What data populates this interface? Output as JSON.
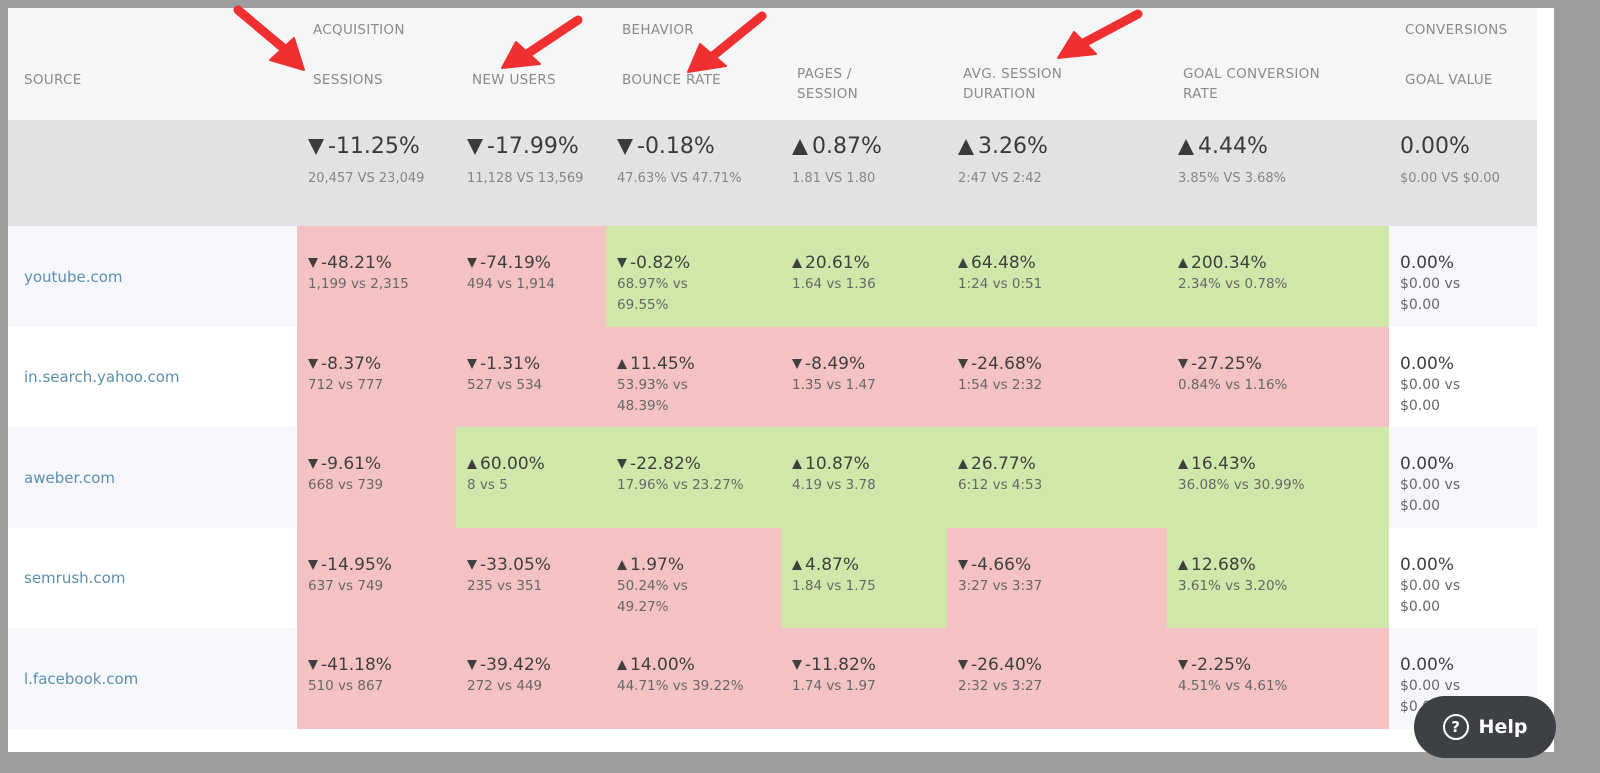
{
  "header": {
    "groups": {
      "acquisition": "ACQUISITION",
      "behavior": "BEHAVIOR",
      "conversions": "CONVERSIONS"
    },
    "columns": {
      "source": "SOURCE",
      "sessions": "SESSIONS",
      "new_users": "NEW USERS",
      "bounce_rate": "BOUNCE RATE",
      "pages_session_l1": "PAGES /",
      "pages_session_l2": "SESSION",
      "avg_session_l1": "AVG. SESSION",
      "avg_session_l2": "DURATION",
      "goal_conv_l1": "GOAL CONVERSION",
      "goal_conv_l2": "RATE",
      "goal_value": "GOAL VALUE"
    }
  },
  "colors": {
    "negative_cell": "#f4c2c2",
    "positive_cell": "#cfe8a9",
    "arrow_red": "#e0353b",
    "arrow_green": "#6aa33a",
    "annotation_arrow": "#f03030",
    "link": "#5a8fb0"
  },
  "summary": {
    "sessions": {
      "change": "-11.25%",
      "direction": "down",
      "tone": "red",
      "compare": "20,457 VS 23,049"
    },
    "new_users": {
      "change": "-17.99%",
      "direction": "down",
      "tone": "red",
      "compare": "11,128 VS 13,569"
    },
    "bounce_rate": {
      "change": "-0.18%",
      "direction": "down",
      "tone": "green",
      "compare": "47.63% VS 47.71%"
    },
    "pages_session": {
      "change": "0.87%",
      "direction": "up",
      "tone": "green",
      "compare": "1.81 VS 1.80"
    },
    "avg_session": {
      "change": "3.26%",
      "direction": "up",
      "tone": "green",
      "compare": "2:47 VS 2:42"
    },
    "goal_conv": {
      "change": "4.44%",
      "direction": "up",
      "tone": "green",
      "compare": "3.85% VS 3.68%"
    },
    "goal_value": {
      "change": "0.00%",
      "compare": "$0.00 VS $0.00"
    }
  },
  "rows": [
    {
      "source": "youtube.com",
      "sessions": {
        "change": "-48.21%",
        "direction": "down",
        "tone": "red",
        "compare": "1,199 vs 2,315"
      },
      "new_users": {
        "change": "-74.19%",
        "direction": "down",
        "tone": "red",
        "compare": "494 vs 1,914"
      },
      "bounce_rate": {
        "change": "-0.82%",
        "direction": "down",
        "tone": "green",
        "compare": "68.97% vs 69.55%"
      },
      "pages_session": {
        "change": "20.61%",
        "direction": "up",
        "tone": "green",
        "compare": "1.64 vs 1.36"
      },
      "avg_session": {
        "change": "64.48%",
        "direction": "up",
        "tone": "green",
        "compare": "1:24 vs 0:51"
      },
      "goal_conv": {
        "change": "200.34%",
        "direction": "up",
        "tone": "green",
        "compare": "2.34% vs 0.78%"
      },
      "goal_value": {
        "change": "0.00%",
        "compare_1": "$0.00 vs",
        "compare_2": "$0.00"
      }
    },
    {
      "source": "in.search.yahoo.com",
      "sessions": {
        "change": "-8.37%",
        "direction": "down",
        "tone": "red",
        "compare": "712 vs 777"
      },
      "new_users": {
        "change": "-1.31%",
        "direction": "down",
        "tone": "red",
        "compare": "527 vs 534"
      },
      "bounce_rate": {
        "change": "11.45%",
        "direction": "up",
        "tone": "red",
        "compare": "53.93% vs 48.39%"
      },
      "pages_session": {
        "change": "-8.49%",
        "direction": "down",
        "tone": "red",
        "compare": "1.35 vs 1.47"
      },
      "avg_session": {
        "change": "-24.68%",
        "direction": "down",
        "tone": "red",
        "compare": "1:54 vs 2:32"
      },
      "goal_conv": {
        "change": "-27.25%",
        "direction": "down",
        "tone": "red",
        "compare": "0.84% vs 1.16%"
      },
      "goal_value": {
        "change": "0.00%",
        "compare_1": "$0.00 vs",
        "compare_2": "$0.00"
      }
    },
    {
      "source": "aweber.com",
      "sessions": {
        "change": "-9.61%",
        "direction": "down",
        "tone": "red",
        "compare": "668 vs 739"
      },
      "new_users": {
        "change": "60.00%",
        "direction": "up",
        "tone": "green",
        "compare": "8 vs 5"
      },
      "bounce_rate": {
        "change": "-22.82%",
        "direction": "down",
        "tone": "green",
        "compare": "17.96% vs 23.27%"
      },
      "pages_session": {
        "change": "10.87%",
        "direction": "up",
        "tone": "green",
        "compare": "4.19 vs 3.78"
      },
      "avg_session": {
        "change": "26.77%",
        "direction": "up",
        "tone": "green",
        "compare": "6:12 vs 4:53"
      },
      "goal_conv": {
        "change": "16.43%",
        "direction": "up",
        "tone": "green",
        "compare": "36.08% vs 30.99%"
      },
      "goal_value": {
        "change": "0.00%",
        "compare_1": "$0.00 vs",
        "compare_2": "$0.00"
      }
    },
    {
      "source": "semrush.com",
      "sessions": {
        "change": "-14.95%",
        "direction": "down",
        "tone": "red",
        "compare": "637 vs 749"
      },
      "new_users": {
        "change": "-33.05%",
        "direction": "down",
        "tone": "red",
        "compare": "235 vs 351"
      },
      "bounce_rate": {
        "change": "1.97%",
        "direction": "up",
        "tone": "red",
        "compare": "50.24% vs 49.27%"
      },
      "pages_session": {
        "change": "4.87%",
        "direction": "up",
        "tone": "green",
        "compare": "1.84 vs 1.75"
      },
      "avg_session": {
        "change": "-4.66%",
        "direction": "down",
        "tone": "red",
        "compare": "3:27 vs 3:37"
      },
      "goal_conv": {
        "change": "12.68%",
        "direction": "up",
        "tone": "green",
        "compare": "3.61% vs 3.20%"
      },
      "goal_value": {
        "change": "0.00%",
        "compare_1": "$0.00 vs",
        "compare_2": "$0.00"
      }
    },
    {
      "source": "l.facebook.com",
      "sessions": {
        "change": "-41.18%",
        "direction": "down",
        "tone": "red",
        "compare": "510 vs 867"
      },
      "new_users": {
        "change": "-39.42%",
        "direction": "down",
        "tone": "red",
        "compare": "272 vs 449"
      },
      "bounce_rate": {
        "change": "14.00%",
        "direction": "up",
        "tone": "red",
        "compare": "44.71% vs 39.22%"
      },
      "pages_session": {
        "change": "-11.82%",
        "direction": "down",
        "tone": "red",
        "compare": "1.74 vs 1.97"
      },
      "avg_session": {
        "change": "-26.40%",
        "direction": "down",
        "tone": "red",
        "compare": "2:32 vs 3:27"
      },
      "goal_conv": {
        "change": "-2.25%",
        "direction": "down",
        "tone": "red",
        "compare": "4.51% vs 4.61%"
      },
      "goal_value": {
        "change": "0.00%",
        "compare_1": "$0.00 vs",
        "compare_2": "$0.00"
      }
    }
  ],
  "help_button": {
    "label": "Help",
    "icon": "question-circle-icon"
  }
}
